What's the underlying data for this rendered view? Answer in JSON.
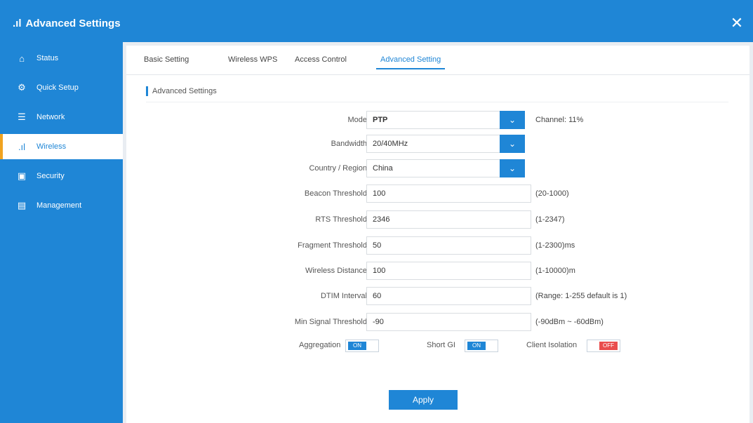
{
  "window": {
    "title": "Advanced Settings"
  },
  "sidebar": {
    "items": [
      {
        "label": "Status",
        "icon": "home-icon"
      },
      {
        "label": "Quick Setup",
        "icon": "gear-icon"
      },
      {
        "label": "Network",
        "icon": "network-icon"
      },
      {
        "label": "Wireless",
        "icon": "signal-icon"
      },
      {
        "label": "Security",
        "icon": "security-icon"
      },
      {
        "label": "Management",
        "icon": "management-icon"
      }
    ]
  },
  "tabs": [
    "Basic Setting",
    "Wireless WPS",
    "Access Control",
    "Advanced Setting"
  ],
  "section": {
    "title": "Advanced Settings"
  },
  "form": {
    "mode": {
      "label": "Mode",
      "value": "PTP",
      "note": "Channel: 11%"
    },
    "bandwidth": {
      "label": "Bandwidth",
      "value": "20/40MHz"
    },
    "country": {
      "label": "Country / Region",
      "value": "China"
    },
    "beacon": {
      "label": "Beacon Threshold",
      "value": "100",
      "note": "(20-1000)"
    },
    "rts": {
      "label": "RTS Threshold",
      "value": "2346",
      "note": "(1-2347)"
    },
    "frag": {
      "label": "Fragment Threshold",
      "value": "50",
      "note": "(1-2300)ms"
    },
    "distance": {
      "label": "Wireless Distance",
      "value": "100",
      "note": "(1-10000)m"
    },
    "dtim": {
      "label": "DTIM Interval",
      "value": "60",
      "note": "(Range: 1-255 default is 1)"
    },
    "signal": {
      "label": "Min Signal Threshold",
      "value": "-90",
      "note": "(-90dBm ~ -60dBm)"
    }
  },
  "toggles": {
    "aggregation": {
      "label": "Aggregation",
      "state": "ON"
    },
    "shortgi": {
      "label": "Short GI",
      "state": "ON"
    },
    "isolation": {
      "label": "Client Isolation",
      "state": "OFF"
    }
  },
  "apply_label": "Apply",
  "colors": {
    "primary": "#1f86d6",
    "accent": "#f0a320",
    "off": "#e94d4d"
  }
}
